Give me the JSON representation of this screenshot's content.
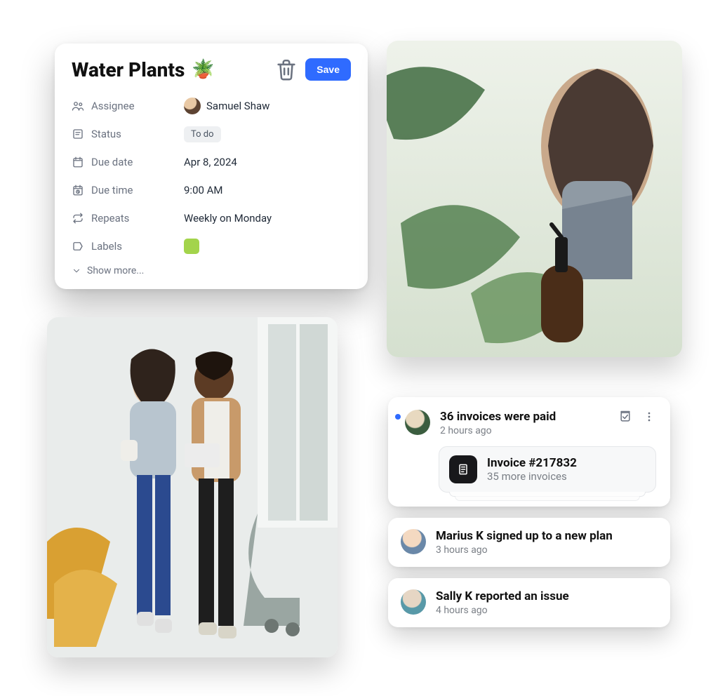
{
  "task": {
    "title": "Water Plants",
    "emoji": "🪴",
    "save_label": "Save",
    "rows": {
      "assignee_label": "Assignee",
      "assignee_value": "Samuel Shaw",
      "status_label": "Status",
      "status_value": "To do",
      "due_date_label": "Due date",
      "due_date_value": "Apr 8, 2024",
      "due_time_label": "Due time",
      "due_time_value": "9:00 AM",
      "repeats_label": "Repeats",
      "repeats_value": "Weekly on Monday",
      "labels_label": "Labels"
    },
    "label_color": "#a3d44b",
    "show_more": "Show more..."
  },
  "notifications": {
    "main": {
      "title": "36 invoices were paid",
      "time": "2 hours ago",
      "invoice_title": "Invoice #217832",
      "invoice_sub": "35 more invoices"
    },
    "items": [
      {
        "title": "Marius K signed up to a new plan",
        "time": "3 hours ago"
      },
      {
        "title": "Sally K reported an issue",
        "time": "4 hours ago"
      }
    ]
  }
}
